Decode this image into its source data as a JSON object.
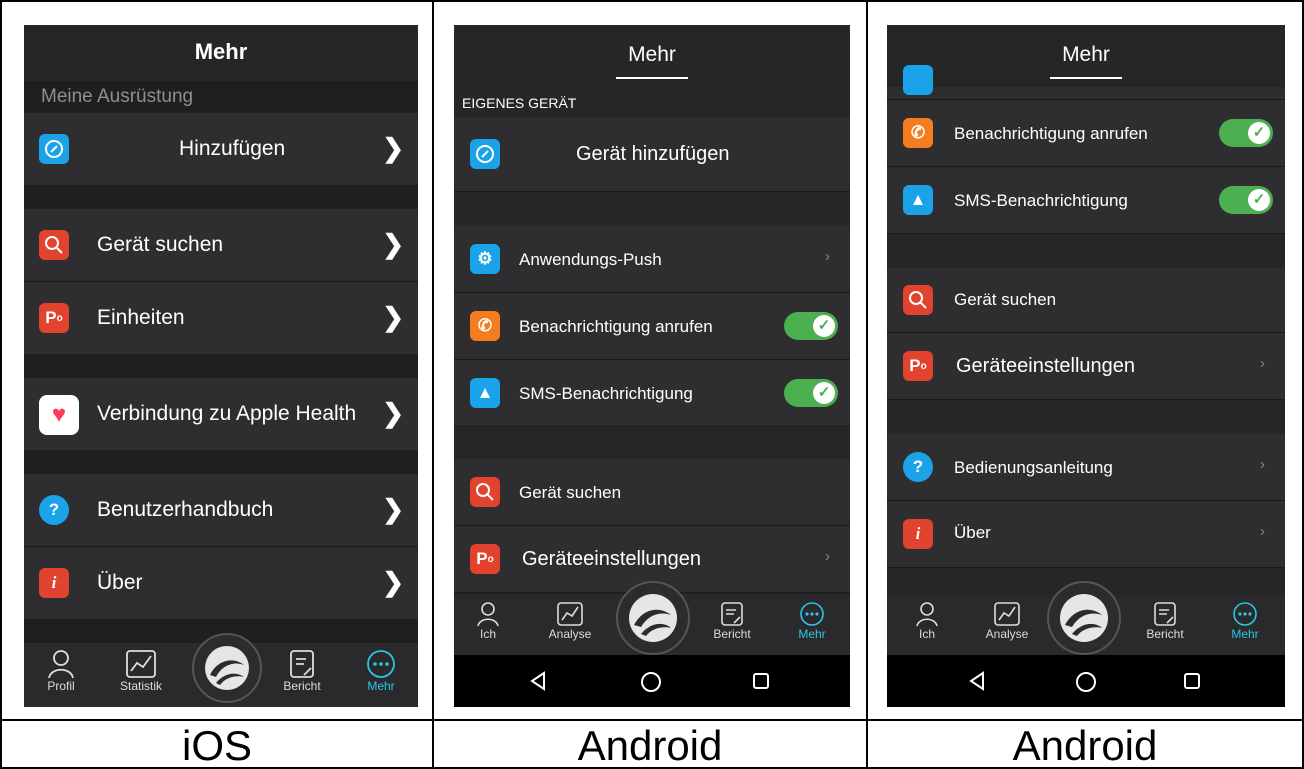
{
  "captions": [
    "iOS",
    "Android",
    "Android"
  ],
  "ios": {
    "title": "Mehr",
    "section": "Meine Ausrüstung",
    "add": "Hinzufügen",
    "find": "Gerät suchen",
    "units": "Einheiten",
    "health": "Verbindung zu Apple Health",
    "manual": "Benutzerhandbuch",
    "about": "Über",
    "tabs": [
      "Profil",
      "Statistik",
      "Bericht",
      "Mehr"
    ]
  },
  "android1": {
    "title": "Mehr",
    "section": "EIGENES GERÄT",
    "add": "Gerät hinzufügen",
    "push": "Anwendungs-Push",
    "call": "Benachrichtigung anrufen",
    "sms": "SMS-Benachrichtigung",
    "find": "Gerät suchen",
    "settings": "Geräteeinstellungen",
    "tabs": [
      "Ich",
      "Analyse",
      "Bericht",
      "Mehr"
    ]
  },
  "android2": {
    "title": "Mehr",
    "call": "Benachrichtigung anrufen",
    "sms": "SMS-Benachrichtigung",
    "find": "Gerät suchen",
    "settings": "Geräteeinstellungen",
    "manual": "Bedienungsanleitung",
    "about": "Über",
    "tabs": [
      "Ich",
      "Analyse",
      "Bericht",
      "Mehr"
    ]
  },
  "colors": {
    "accent": "#2ec4e6",
    "toggle": "#4caf50",
    "blue": "#1aa3e8",
    "red": "#e2432e",
    "orange": "#f57c1f"
  },
  "toggles": {
    "android1_call": true,
    "android1_sms": true,
    "android2_call": true,
    "android2_sms": true
  }
}
